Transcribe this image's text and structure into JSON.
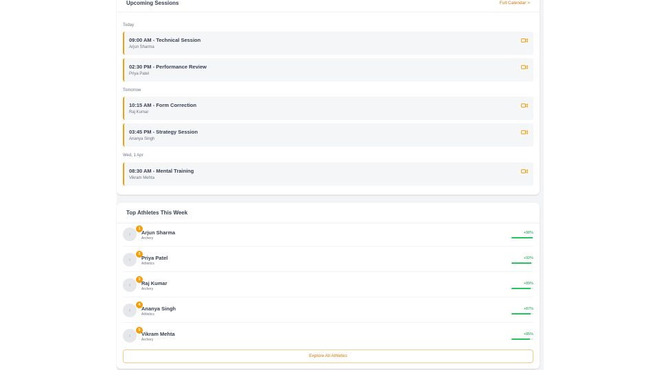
{
  "sessions_card": {
    "title": "Upcoming Sessions",
    "link_label": "Full Calendar >",
    "groups": [
      {
        "label": "Today",
        "sessions": [
          {
            "title": "09:00 AM - Technical Session",
            "athlete": "Arjun Sharma",
            "icon": "video-icon"
          },
          {
            "title": "02:30 PM - Performance Review",
            "athlete": "Priya Patel",
            "icon": "video-icon"
          }
        ]
      },
      {
        "label": "Tomorrow",
        "sessions": [
          {
            "title": "10:15 AM - Form Correction",
            "athlete": "Raj Kumar",
            "icon": "video-icon"
          },
          {
            "title": "03:45 PM - Strategy Session",
            "athlete": "Ananya Singh",
            "icon": "video-icon"
          }
        ]
      },
      {
        "label": "Wed, 1 Apr",
        "sessions": [
          {
            "title": "08:30 AM - Mental Training",
            "athlete": "Vikram Mehta",
            "icon": "video-icon"
          }
        ]
      }
    ]
  },
  "athletes_card": {
    "title": "Top Athletes This Week",
    "athletes": [
      {
        "rank": "1",
        "name": "Arjun Sharma",
        "sport": "Archery",
        "score": "+98%",
        "progress": 0.98
      },
      {
        "rank": "2",
        "name": "Priya Patel",
        "sport": "Athletics",
        "score": "+92%",
        "progress": 0.92
      },
      {
        "rank": "3",
        "name": "Raj Kumar",
        "sport": "Archery",
        "score": "+89%",
        "progress": 0.89
      },
      {
        "rank": "4",
        "name": "Ananya Singh",
        "sport": "Athletics",
        "score": "+87%",
        "progress": 0.87
      },
      {
        "rank": "5",
        "name": "Vikram Mehta",
        "sport": "Archery",
        "score": "+85%",
        "progress": 0.85
      }
    ],
    "explore_label": "Explore All Athletes"
  },
  "colors": {
    "accent": "#f59e0b",
    "link": "#d97706",
    "positive": "#16a34a",
    "progress": "#22c55e",
    "card_bg": "#ffffff",
    "session_bg": "#f5f6f8",
    "page_bg": "#f3f4f6"
  }
}
